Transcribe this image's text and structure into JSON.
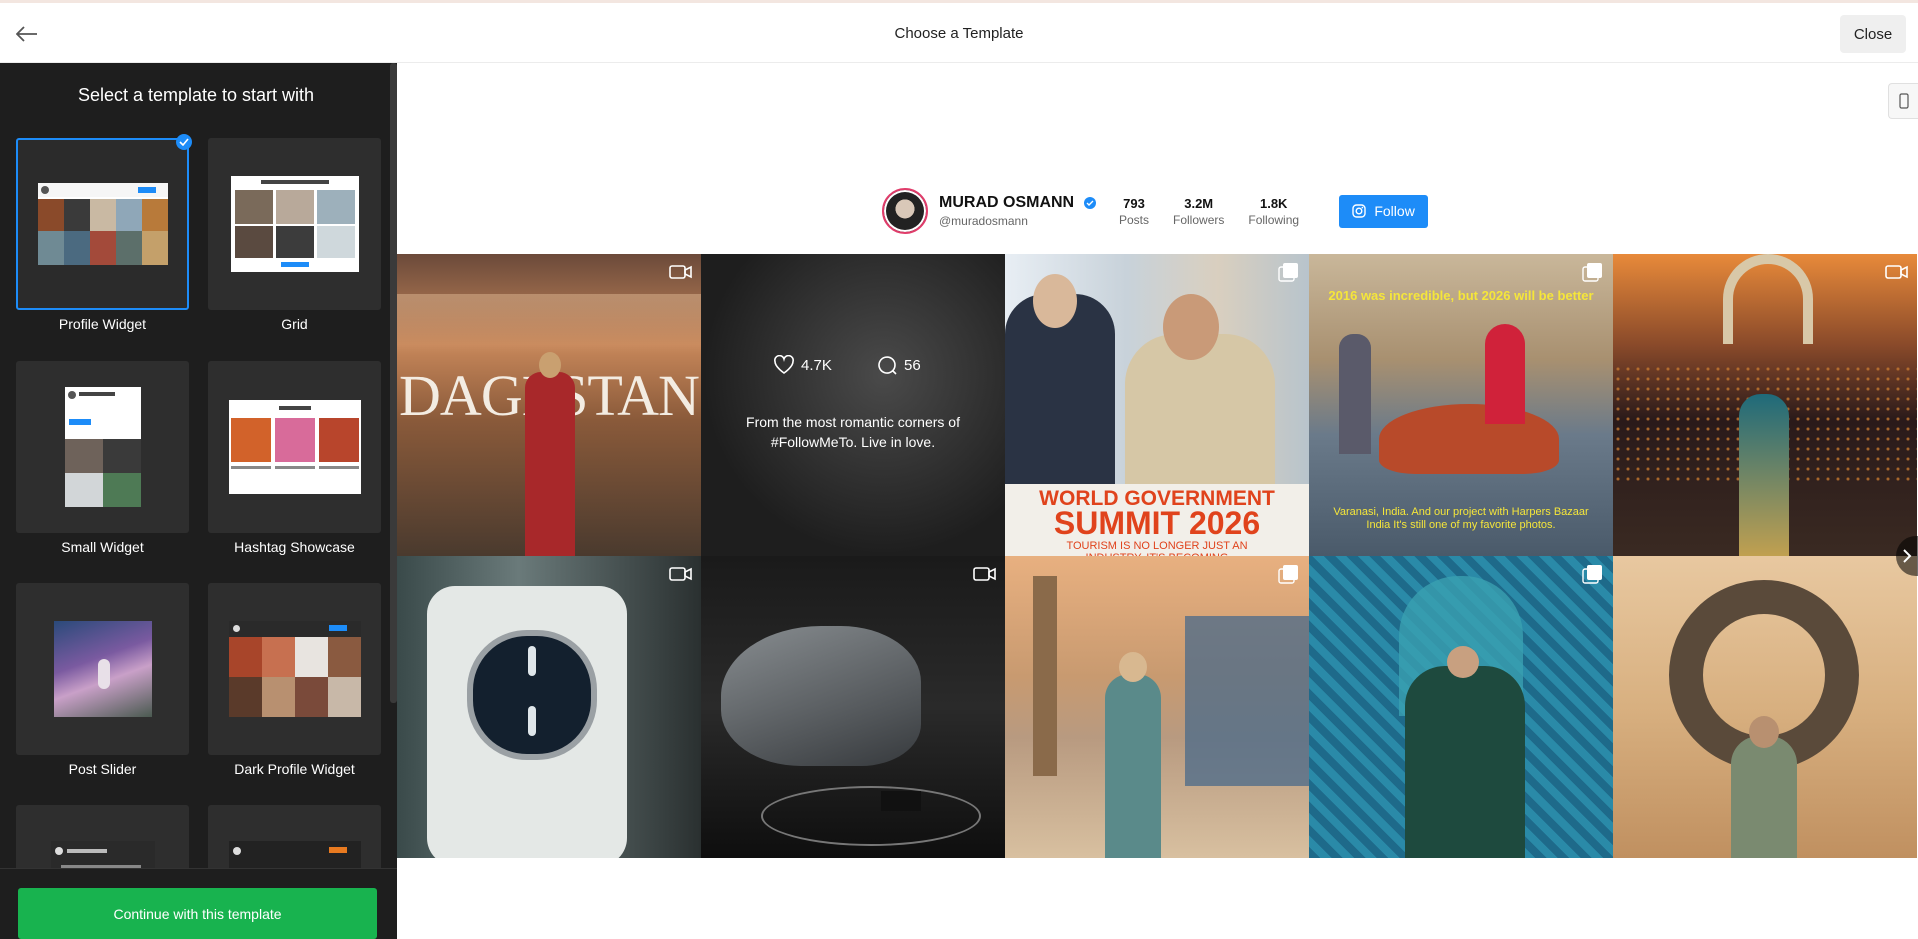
{
  "topbar": {
    "title": "Choose a Template",
    "close_label": "Close"
  },
  "sidebar": {
    "heading": "Select a template to start with",
    "templates": [
      {
        "label": "Profile Widget",
        "selected": true
      },
      {
        "label": "Grid"
      },
      {
        "label": "Small Widget"
      },
      {
        "label": "Hashtag Showcase"
      },
      {
        "label": "Post Slider"
      },
      {
        "label": "Dark Profile Widget"
      }
    ],
    "continue_label": "Continue with this template"
  },
  "profile": {
    "name": "MURAD OSMANN",
    "handle": "@muradosmann",
    "stats": [
      {
        "value": "793",
        "label": "Posts"
      },
      {
        "value": "3.2M",
        "label": "Followers"
      },
      {
        "value": "1.8K",
        "label": "Following"
      }
    ],
    "follow_label": "Follow"
  },
  "posts": {
    "p1_title": "DAGESTAN",
    "p2_likes": "4.7K",
    "p2_comments": "56",
    "p2_caption": "From the most romantic corners of #FollowMeTo. Live in love.",
    "p3_headline1": "WORLD GOVERNMENT",
    "p3_headline2": "SUMMIT 2026",
    "p3_sub": "TOURISM IS NO LONGER JUST AN INDUSTRY. IT'S BECOMING",
    "p4_top": "2016 was incredible, but 2026 will be better",
    "p4_bottom": "Varanasi, India. And our project with Harpers Bazaar India It's still one of my favorite photos."
  },
  "colors": {
    "accent": "#1d8cf8",
    "continue": "#18b34f",
    "sidebar_bg": "#1e1e1e"
  }
}
